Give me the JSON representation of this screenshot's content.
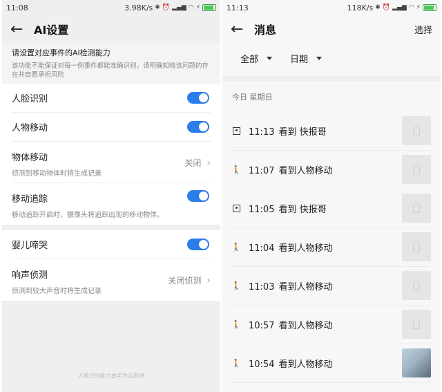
{
  "left": {
    "status": {
      "time": "11:08",
      "net": "3.98K/s",
      "icons": [
        "bluetooth-icon",
        "alarm-icon",
        "signal-icon",
        "wifi-icon",
        "charging-icon",
        "battery-icon"
      ]
    },
    "title": "AI设置",
    "note": {
      "title": "请设置对应事件的AI检测能力",
      "desc": "该功能不能保证对每一例事件都能准确识别，请明确知晓该问题的存在并自愿承担风险"
    },
    "items1": [
      {
        "label": "人脸识别",
        "toggle": true
      },
      {
        "label": "人物移动",
        "toggle": true
      },
      {
        "label": "物体移动",
        "sub": "侦测到移动物体时将生成记录",
        "value": "关闭"
      },
      {
        "label": "移动追踪",
        "sub": "移动追踪开启时，摄像头将追踪出现的移动物体。",
        "toggle": true
      }
    ],
    "items2": [
      {
        "label": "婴儿啼哭",
        "toggle": true
      },
      {
        "label": "响声侦测",
        "sub": "侦测到较大声音时将生成记录",
        "value": "关闭侦测"
      }
    ],
    "footer": "人脸识别能力由华为云提供",
    "accent": "#2b7de9"
  },
  "right": {
    "status": {
      "time": "11:13",
      "net": "118K/s",
      "icons": [
        "bluetooth-icon",
        "alarm-icon",
        "signal-icon",
        "wifi-icon",
        "charging-icon",
        "battery-icon"
      ]
    },
    "title": "消息",
    "select": "选择",
    "filters": [
      "全部",
      "日期"
    ],
    "date_header": "今日 星期日",
    "messages": [
      {
        "time": "11:13",
        "text": "看到 快报哥",
        "icon": "face-icon",
        "thumb": "placeholder"
      },
      {
        "time": "11:07",
        "text": "看到人物移动",
        "icon": "walking-person-icon",
        "thumb": "placeholder"
      },
      {
        "time": "11:05",
        "text": "看到 快报哥",
        "icon": "face-icon",
        "thumb": "placeholder"
      },
      {
        "time": "11:04",
        "text": "看到人物移动",
        "icon": "walking-person-icon",
        "thumb": "placeholder"
      },
      {
        "time": "11:03",
        "text": "看到人物移动",
        "icon": "walking-person-icon",
        "thumb": "placeholder"
      },
      {
        "time": "10:57",
        "text": "看到人物移动",
        "icon": "walking-person-icon",
        "thumb": "placeholder"
      },
      {
        "time": "10:54",
        "text": "看到人物移动",
        "icon": "walking-person-icon",
        "thumb": "photo"
      }
    ]
  }
}
